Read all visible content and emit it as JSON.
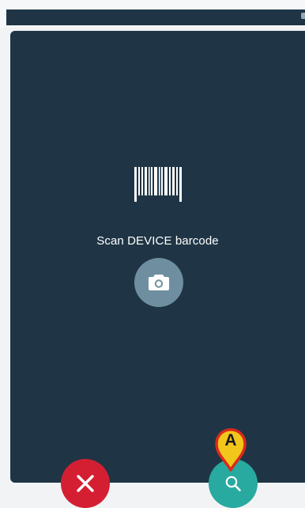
{
  "scanner": {
    "prompt": "Scan DEVICE barcode"
  },
  "icons": {
    "barcode": "barcode-icon",
    "camera": "camera-icon",
    "cancel": "close-icon",
    "search": "search-icon",
    "marker": "map-pin-marker-icon"
  },
  "annotation": {
    "marker_label": "A"
  },
  "colors": {
    "panel": "#1f3545",
    "camera_button": "#6f8fa1",
    "cancel_button": "#d41f33",
    "search_button": "#28aaa0",
    "marker_fill": "#f3c61b",
    "marker_outline": "#d92a1c"
  }
}
